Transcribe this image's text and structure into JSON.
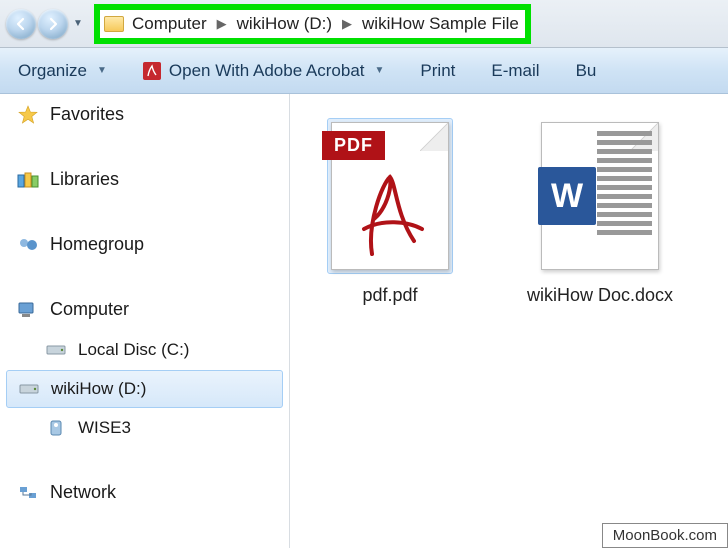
{
  "breadcrumb": {
    "parts": [
      "Computer",
      "wikiHow (D:)",
      "wikiHow Sample File"
    ]
  },
  "toolbar": {
    "organize": "Organize",
    "open_with": "Open With Adobe Acrobat",
    "print": "Print",
    "email": "E-mail",
    "burn": "Bu"
  },
  "sidebar": {
    "favorites": "Favorites",
    "libraries": "Libraries",
    "homegroup": "Homegroup",
    "computer": "Computer",
    "drives": {
      "c": "Local Disc (C:)",
      "d": "wikiHow (D:)",
      "w": "WISE3"
    },
    "network": "Network"
  },
  "files": {
    "pdf": {
      "label": "pdf.pdf",
      "badge": "PDF"
    },
    "docx": {
      "label": "wikiHow Doc.docx",
      "badge": "W"
    }
  },
  "watermark": "MoonBook.com"
}
